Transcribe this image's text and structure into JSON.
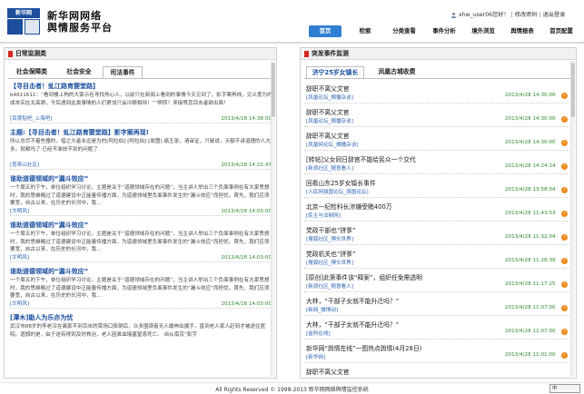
{
  "header": {
    "logo_text": "新华网",
    "title_line1": "新华网网络",
    "title_line2": "舆情服务平台",
    "user_name": "xhw_user06",
    "greeting": "您好！",
    "change_password": "修改密码",
    "logout": "退出登录",
    "separator": "|"
  },
  "nav": {
    "items": [
      {
        "label": "首页"
      },
      {
        "label": "检索"
      },
      {
        "label": "分类查看"
      },
      {
        "label": "事件分析"
      },
      {
        "label": "境外浏览"
      },
      {
        "label": "舆情报表"
      },
      {
        "label": "首页配置"
      }
    ],
    "active_index": 0
  },
  "left_panel": {
    "title": "日常监测类",
    "tabs": [
      {
        "label": "社会保障类"
      },
      {
        "label": "社会安全"
      },
      {
        "label": "司法事件"
      }
    ],
    "active_tab": 2,
    "articles": [
      {
        "title": "【寻目击者！虬江路育婴堂路】",
        "summary": "b4611611：“看到楼上构的大家示在寻找热心人，以前只在新闻上看到的事情今天见到了，影字案再线，见义勇为的成本实在太高昂，令后遇到此类事情的人们更加只会冷眼相待！”“啊转！来接等其目击者欲出面！",
        "source": "[百度贴吧_上海吧]",
        "date": "2013/4/28 14:38:00"
      },
      {
        "title": "主题:【寻目击者！虬江路育婴堂路】影字案再现!",
        "summary": "所以总尽不着些撞的，借之大者永远是为的[阿拉伯] [阿拉伯] [原图] 痛玉张，请审证，只疑说，天额不讲道理的人大多。就都吗了 已经不准扶不到的问题了",
        "source": "[宽带山社区]",
        "date": "2013/4/28 14:22:47"
      },
      {
        "title": "谁助道德领域的“漏斗效应”",
        "summary": "一个周五的下午，单位组织学习讨论，主题是关于“道德领域存在的问题”，当主讲人举出三个负面事例在有大家思想时，我的思维略过了道德建设中正能量传播方面，为道德领域里负面事件发生的“漏斗效应”而担忧。首先，我们应须要宽，自古以来，在历史的长河中，我...",
        "source": "[文明风]",
        "date": "2013/4/28 14:03:00"
      },
      {
        "title": "谁助道德领域的“漏斗效应”",
        "summary": "一个周五的下午，单位组织学习讨论，主题是关于“道德领域存在的问题”，当主讲人举出三个负面事例在有大家思想时，我的思维略过了道德建设中正能量传播方面，为道德领域里负面事件发生的“漏斗效应”而担忧。首先，我们应须要宽，自古以来，在历史的长河中，我...",
        "source": "[文明风]",
        "date": "2013/4/28 14:03:00"
      },
      {
        "title": "谁助道德领域的“漏斗效应”",
        "summary": "一个周五的下午，单位组织学习讨论，主题是关于“道德领域存在的问题”，当主讲人举出三个负面事例在有大家思想时，我的思维略过了道德建设中正能量传播方面，为道德领域里负面事件发生的“漏斗效应”而担忧。首先，我们应须要宽，自古以来，在历史的长河中，我...",
        "source": "[文明风]",
        "date": "2013/4/28 14:03:00"
      },
      {
        "title": "[潭木]勘人为乐亦为忧",
        "summary": "武汉市88岁的李老汉在离家不到百米的菜场口摔倒后，众多围观者无人敢伸出援手，直到老人家人赶到才被送往医院。遗憾的是，由于送有得到及时救治，老人因鼻血堵塞窒息死亡。 自从南京“彭宇",
        "source": "",
        "date": ""
      }
    ]
  },
  "right_panel": {
    "title": "突发事件监测",
    "tabs": [
      {
        "label": "济宁25岁女镇长"
      },
      {
        "label": "凤凰古城收费"
      }
    ],
    "active_tab": 0,
    "events": [
      {
        "title": "辞职不离父文官",
        "source": "[凤凰论坛_搁播杂谈]",
        "date": "2013/4/28 14:30:00"
      },
      {
        "title": "辞职不离父文官",
        "source": "[凤凰论坛_搁播杂谈]",
        "date": "2013/4/28 14:30:00"
      },
      {
        "title": "辞职不离父文官",
        "source": "[凤凰网论坛_搁播杂谈]",
        "date": "2013/4/28 14:30:00"
      },
      {
        "title": "[转帖]父女同日辞官不能给民众一个交代",
        "source": "[新浪社区_随意看人]",
        "date": "2013/4/28 14:24:14"
      },
      {
        "title": "回看山东25岁女镇长事件",
        "source": "[人民网强国论坛_强国论坛]",
        "date": "2013/4/28 13:58:04"
      },
      {
        "title": "北京—纪检科长涉嫌受贿400万",
        "source": "[民主与法制网]",
        "date": "2013/4/28 11:43:53"
      },
      {
        "title": "党政干部也“拼爹”",
        "source": "[搜狐社区_博头世界]",
        "date": "2013/4/28 11:32:04"
      },
      {
        "title": "党政机关也“拼爹”",
        "source": "[搜狐社区_博头世界]",
        "date": "2013/4/28 11:28:39"
      },
      {
        "title": "[原创]此第事件该“释案”，组织任免需透明",
        "source": "[新浪社区_随意看人]",
        "date": "2013/4/28 11:17:25"
      },
      {
        "title": "大林，“干部子女就不能升迁吗？”",
        "source": "[新网_微博动]",
        "date": "2013/4/28 11:07:00"
      },
      {
        "title": "大林，“干部子女就不能升迁吗？”",
        "source": "[金羚在线]",
        "date": "2013/4/28 11:07:00"
      },
      {
        "title": "新华网“舆情在线”一图热点舆情(4月28日)",
        "source": "[新华网]",
        "date": "2013/4/28 11:01:00"
      },
      {
        "title": "辞职不离父文官",
        "source": "",
        "date": ""
      }
    ]
  },
  "footer": {
    "text": "All Rights Reserved © 1998-2013 新华网网络舆情监控系统",
    "lang": "中"
  },
  "colors": {
    "nav_active": "#2e7ed2",
    "link_blue": "#1a4fa0",
    "date_green": "#2c8a2c",
    "accent_red": "#d6281f",
    "event_icon": "#f08a1c"
  },
  "icons": {
    "user": "user-icon",
    "panel_marker": "bookmark-icon",
    "event_arrow": "arrow-circle-icon"
  }
}
